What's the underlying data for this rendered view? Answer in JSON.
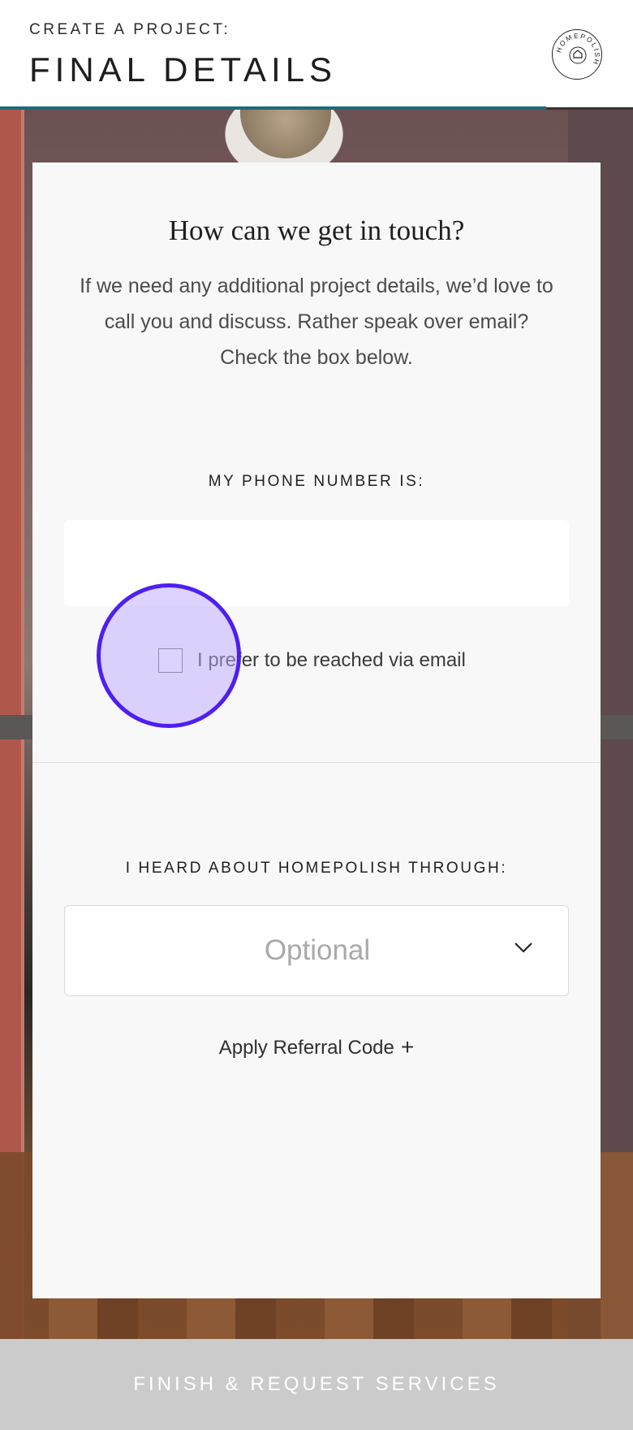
{
  "header": {
    "eyebrow": "CREATE A PROJECT:",
    "title": "FINAL DETAILS",
    "logo_text": "HOMEPOLISH"
  },
  "card": {
    "heading": "How can we get in touch?",
    "intro": "If we need any additional project details, we’d love to call you and discuss. Rather speak over email? Check the box below.",
    "phone_label": "MY PHONE NUMBER IS:",
    "phone_value": "",
    "email_pref_label": "I prefer to be reached via email",
    "email_pref_checked": false,
    "heard_label": "I HEARD ABOUT HOMEPOLISH THROUGH:",
    "heard_selected": "Optional",
    "referral_label": "Apply Referral Code",
    "referral_icon": "plus-icon"
  },
  "footer": {
    "submit_label": "FINISH & REQUEST SERVICES"
  },
  "colors": {
    "progress": "#1d6b7a",
    "touch_indicator": "#4d1ff0",
    "footer_bg": "#cbcbcb"
  }
}
